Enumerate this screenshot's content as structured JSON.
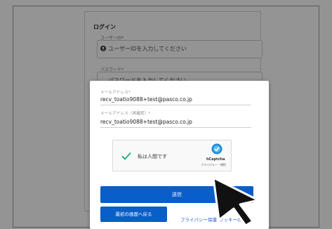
{
  "login": {
    "title": "ログイン",
    "user_id_label": "ユーザーID*",
    "user_id_placeholder": "ユーザーIDを入力してください",
    "password_label": "パスワード*",
    "password_placeholder": "パスワードを入力してください"
  },
  "modal": {
    "email_label": "メールアドレス*",
    "email_value": "recv_toatio9088+test@pasco.co.jp",
    "email_confirm_label": "メールアドレス（再確認）*",
    "email_confirm_value": "recv_toatio9088+test@pasco.co.jp",
    "captcha_text": "私は人間です",
    "captcha_brand": "hCaptcha",
    "captcha_links": "プライバシー・規約",
    "submit_label": "送信",
    "back_label": "最初の画面へ戻る",
    "privacy_link": "プライバシー保護",
    "cookie_link": "クッキーの..."
  },
  "colors": {
    "primary": "#0a5ec8",
    "link": "#2b5fd9",
    "check": "#00a36a"
  }
}
